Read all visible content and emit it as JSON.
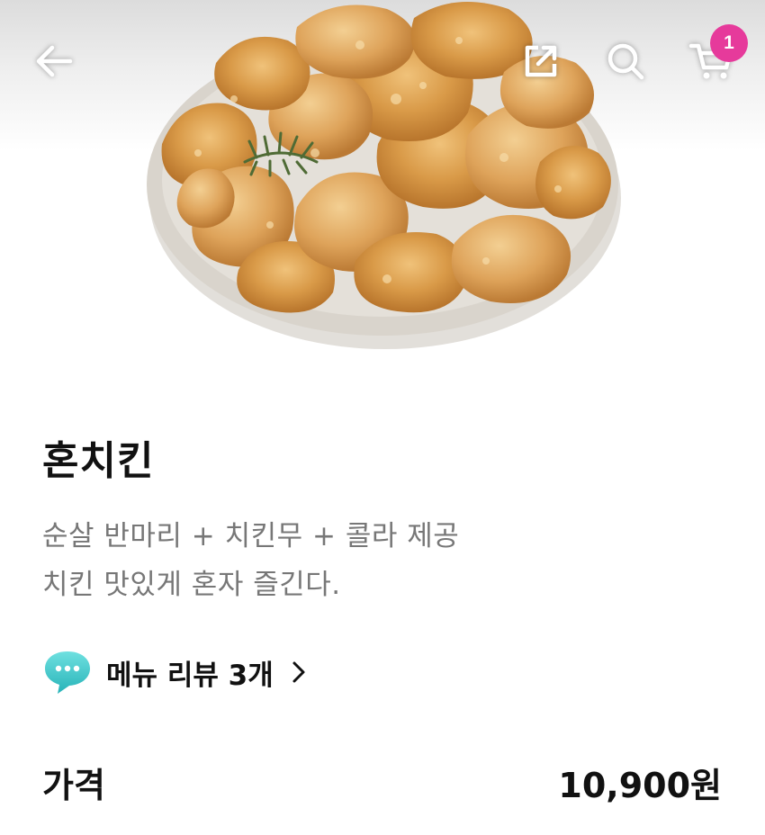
{
  "header": {
    "back_icon": "arrow-left-icon",
    "share_icon": "share-external-icon",
    "search_icon": "search-icon",
    "cart_icon": "cart-icon",
    "cart_count": "1",
    "badge_color": "#e63a9b"
  },
  "product": {
    "image_alt": "fried-chicken-bowl",
    "name": "혼치킨",
    "description_lines": [
      "순살 반마리 + 치킨무 + 콜라 제공",
      "치킨 맛있게 혼자 즐긴다."
    ],
    "review_icon": "chat-bubble-icon",
    "review_label": "메뉴 리뷰 3개",
    "review_chevron": "chevron-right-icon",
    "price_label": "가격",
    "price_value": "10,900원"
  },
  "colors": {
    "text_primary": "#111111",
    "text_secondary": "#777777",
    "review_bubble": "#3fc9c9"
  }
}
